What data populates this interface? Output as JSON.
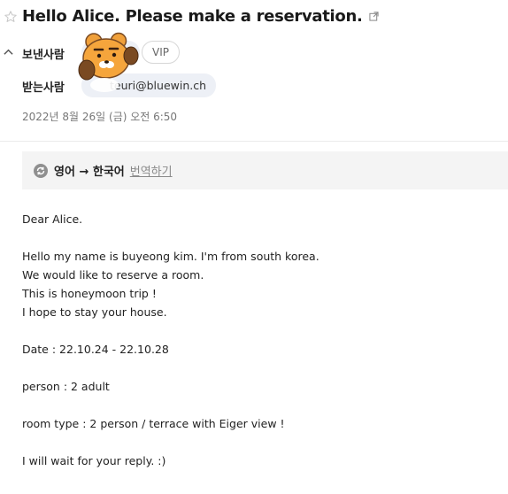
{
  "mail": {
    "subject": "Hello Alice. Please make a reservation.",
    "sender_label": "보낸사람",
    "recipient_label": "받는사람",
    "vip_label": "VIP",
    "recipient_email": "teuri@bluewin.ch",
    "date": "2022년 8월 26일 (금) 오전 6:50"
  },
  "translate": {
    "language_pair": "영어 → 한국어",
    "action_label": "번역하기"
  },
  "body": {
    "greeting": "Dear Alice.",
    "intro_lines": [
      "Hello my name is buyeong kim. I'm from south korea.",
      "We would like to reserve a room.",
      "This is honeymoon trip !",
      "I hope to stay your house."
    ],
    "date_line": "Date : 22.10.24 - 22.10.28",
    "person_line": "person : 2 adult",
    "room_line": "room type : 2 person / terrace with Eiger view !",
    "closing": "I will wait for your reply. :)"
  },
  "icons": {
    "star": "star-outline-icon",
    "popout": "external-link-icon",
    "collapse": "chevron-up-icon",
    "translate": "translate-refresh-icon",
    "avatar": "ryan-character-avatar"
  },
  "colors": {
    "chip_bg": "#edf0f6",
    "translate_bg": "#f4f4f4",
    "avatar_orange": "#f0a03a",
    "avatar_brown": "#7a4a22"
  }
}
